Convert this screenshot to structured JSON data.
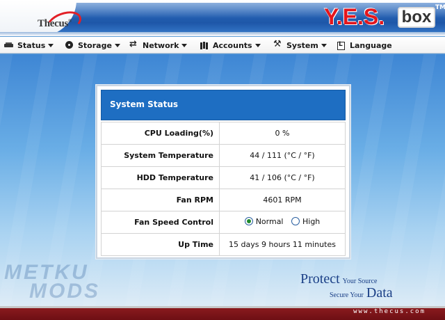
{
  "brand": {
    "vendor_name": "Thecus",
    "vendor_tm": "®",
    "product_name": "Y.E.S.",
    "product_box": "box",
    "product_tm": "TM"
  },
  "menu": {
    "items": [
      {
        "label": "Status",
        "icon": "status-icon",
        "has_dropdown": true
      },
      {
        "label": "Storage",
        "icon": "storage-icon",
        "has_dropdown": true
      },
      {
        "label": "Network",
        "icon": "network-icon",
        "has_dropdown": true
      },
      {
        "label": "Accounts",
        "icon": "accounts-icon",
        "has_dropdown": true
      },
      {
        "label": "System",
        "icon": "system-icon",
        "has_dropdown": true
      },
      {
        "label": "Language",
        "icon": "language-icon",
        "has_dropdown": false
      }
    ]
  },
  "panel": {
    "title": "System Status",
    "rows": [
      {
        "label": "CPU Loading(%)",
        "value": "0 %"
      },
      {
        "label": "System Temperature",
        "value": "44 / 111 (°C / °F)"
      },
      {
        "label": "HDD Temperature",
        "value": "41 / 106 (°C / °F)"
      },
      {
        "label": "Fan RPM",
        "value": "4601 RPM"
      },
      {
        "label": "Fan Speed Control",
        "options": [
          "Normal",
          "High"
        ],
        "selected": "Normal"
      },
      {
        "label": "Up Time",
        "value": "15 days 9 hours 11 minutes"
      }
    ]
  },
  "watermark": {
    "line1": "METKU",
    "line2": "MODS"
  },
  "tagline": {
    "big1": "Protect",
    "small1": "Your Source",
    "small2": "Secure Your",
    "big2": "Data"
  },
  "footer": {
    "url": "www.thecus.com"
  },
  "colors": {
    "title_bar": "#1e6ec2",
    "footer": "#7a1318",
    "logo_red": "#e3161d"
  }
}
